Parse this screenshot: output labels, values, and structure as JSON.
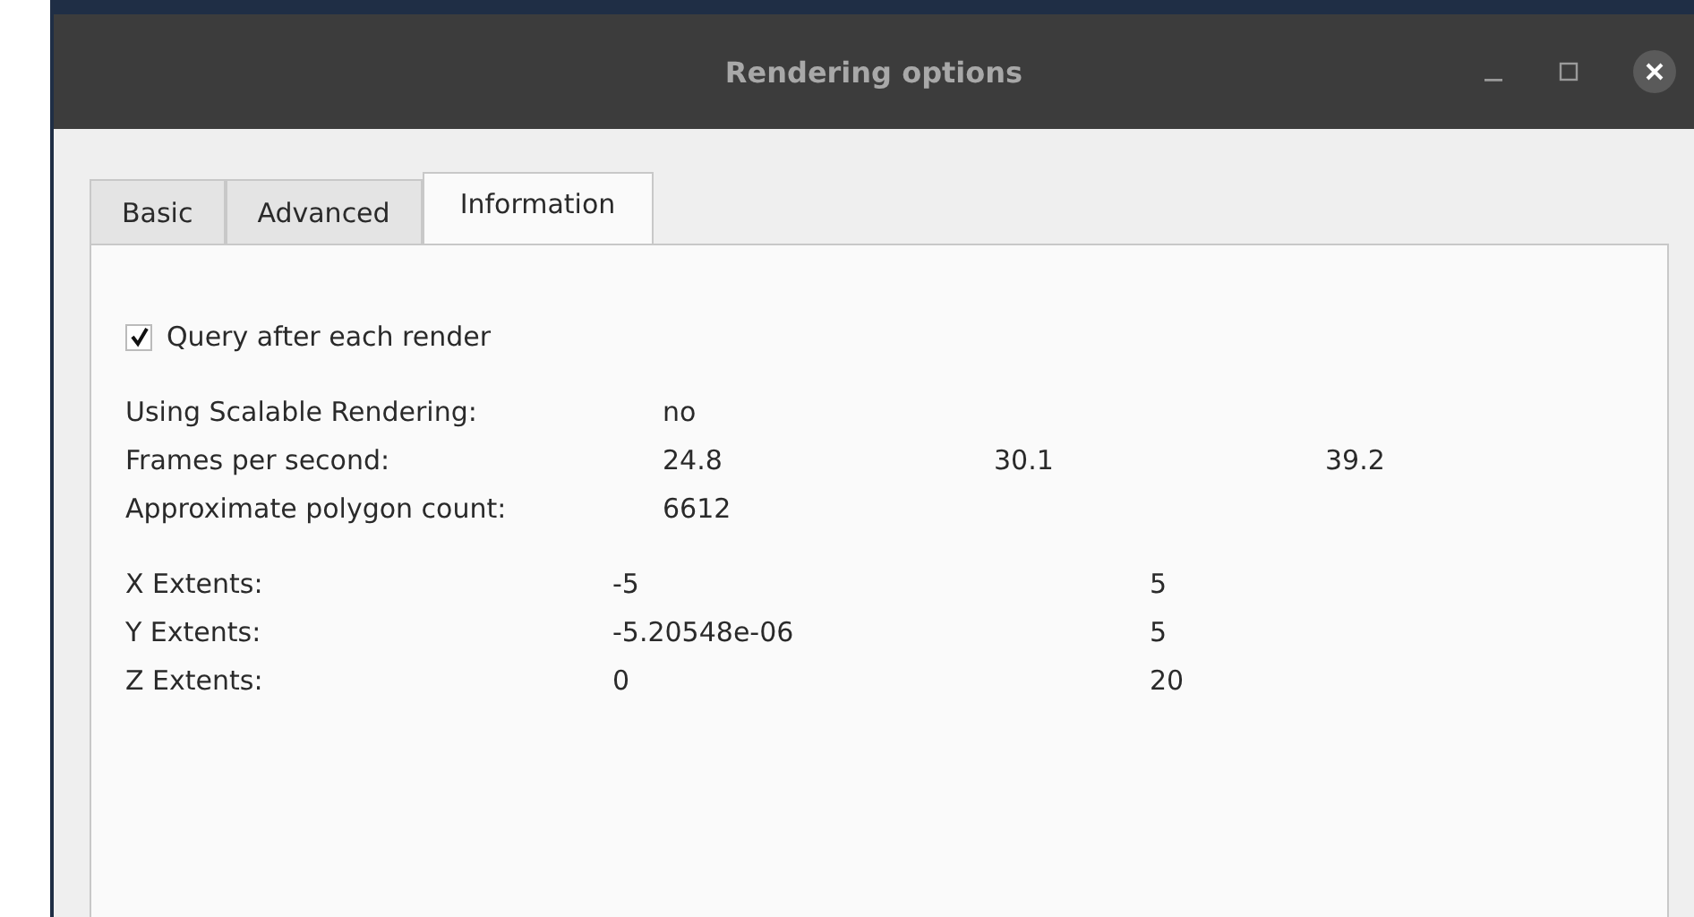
{
  "window": {
    "title": "Rendering options"
  },
  "tabs": [
    {
      "label": "Basic",
      "selected": false
    },
    {
      "label": "Advanced",
      "selected": false
    },
    {
      "label": "Information",
      "selected": true
    }
  ],
  "query_checkbox": {
    "label": "Query after each render",
    "checked": true
  },
  "info_rows": [
    {
      "label": "Using Scalable Rendering:",
      "values": [
        "no"
      ]
    },
    {
      "label": "Frames per second:",
      "values": [
        "24.8",
        "30.1",
        "39.2"
      ]
    },
    {
      "label": "Approximate polygon count:",
      "values": [
        "6612"
      ]
    }
  ],
  "extents": [
    {
      "label": "X Extents:",
      "min": "-5",
      "max": "5"
    },
    {
      "label": "Y Extents:",
      "min": "-5.20548e-06",
      "max": "5"
    },
    {
      "label": "Z Extents:",
      "min": "0",
      "max": "20"
    }
  ]
}
